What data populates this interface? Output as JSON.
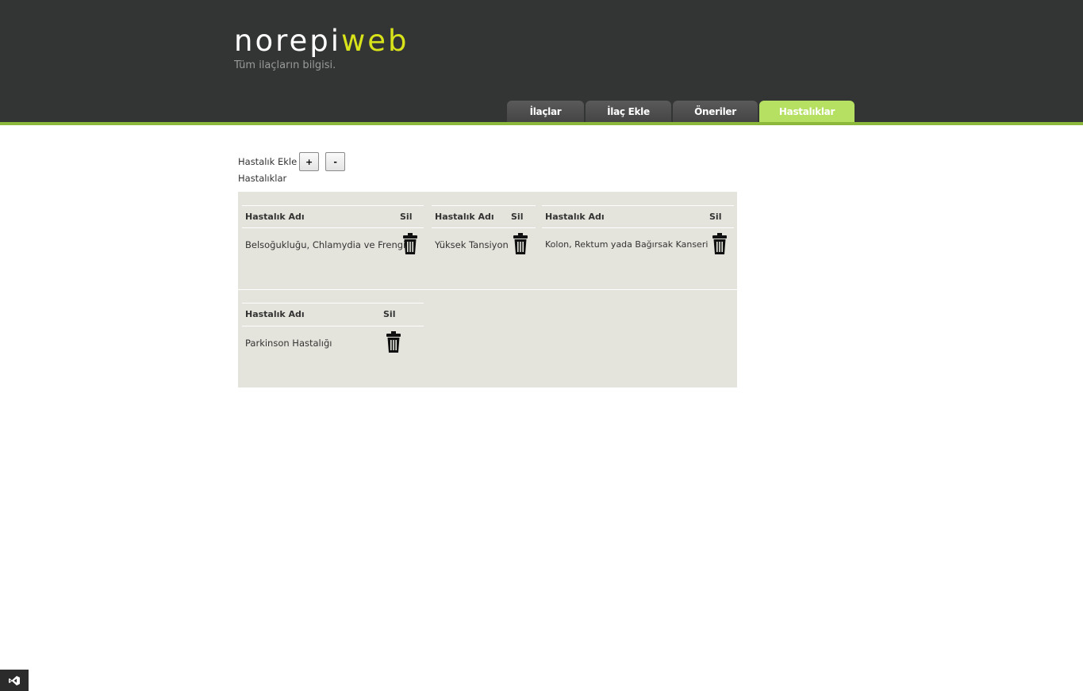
{
  "header": {
    "logo_part1": "norepi",
    "logo_part2": "web",
    "slogan": "Tüm ilaçların bilgisi.",
    "colors": {
      "bg": "#333434",
      "accent_line": "#8cb83c",
      "logo_highlight": "#d8e31a",
      "active_tab": "#b5e061"
    }
  },
  "nav": {
    "tabs": [
      {
        "label": "İlaçlar"
      },
      {
        "label": "İlaç Ekle"
      },
      {
        "label": "Öneriler"
      },
      {
        "label": "Hastalıklar",
        "active": true
      }
    ]
  },
  "main": {
    "add_label": "Hastalık Ekle",
    "plus_label": "+",
    "minus_label": "-",
    "list_title": "Hastalıklar",
    "column_name": "Hastalık Adı",
    "column_delete": "Sil",
    "diseases": [
      "Belsoğukluğu, Chlamydia ve Frengi",
      "Yüksek Tansiyon",
      "Kolon, Rektum yada Bağırsak Kanseri",
      "Parkinson Hastalığı"
    ]
  },
  "icons": {
    "delete": "trash-icon",
    "corner": "visual-studio-icon"
  }
}
